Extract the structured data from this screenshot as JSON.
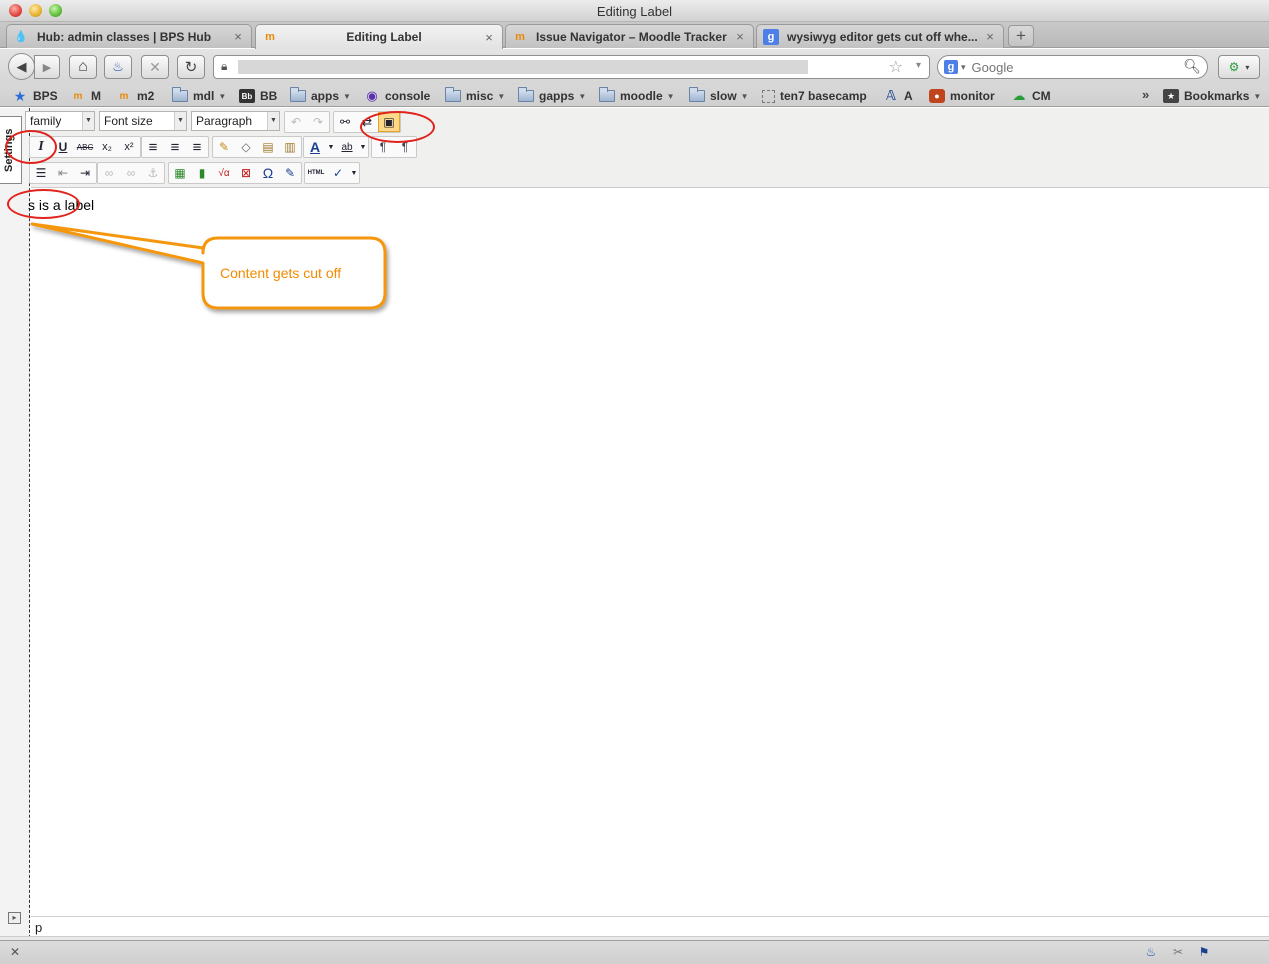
{
  "window": {
    "title": "Editing Label"
  },
  "tabs": [
    {
      "label": "Hub: admin classes | BPS Hub",
      "icon": "drupal-icon",
      "close": "×"
    },
    {
      "label": "Editing Label",
      "icon": "moodle-icon",
      "close": "×"
    },
    {
      "label": "Issue Navigator – Moodle Tracker",
      "icon": "moodle-tracker-icon",
      "close": "×"
    },
    {
      "label": "wysiwyg editor gets cut off whe...",
      "icon": "google-icon",
      "close": "×"
    }
  ],
  "new_tab_label": "+",
  "navbar": {
    "back": "◀",
    "forward": "▶",
    "home": "⌂",
    "firebug": "🔥",
    "stop": "✕",
    "reload": "↻",
    "lock": "🔒",
    "star": "☆",
    "url_dropdown": "▾",
    "search_engine": "g",
    "search_placeholder": "Google",
    "search_icon": "⚲"
  },
  "bookmarks": [
    {
      "label": "BPS",
      "icon": "star-bookmark-icon",
      "dropdown": false
    },
    {
      "label": "M",
      "icon": "moodle-bookmark-icon",
      "dropdown": false
    },
    {
      "label": "m2",
      "icon": "moodle-bookmark-icon",
      "dropdown": false
    },
    {
      "label": "mdl",
      "icon": "folder-icon",
      "dropdown": true
    },
    {
      "label": "BB",
      "icon": "blackboard-icon",
      "dropdown": false
    },
    {
      "label": "apps",
      "icon": "folder-icon",
      "dropdown": true
    },
    {
      "label": "console",
      "icon": "console-icon",
      "dropdown": false
    },
    {
      "label": "misc",
      "icon": "folder-icon",
      "dropdown": true
    },
    {
      "label": "gapps",
      "icon": "folder-icon",
      "dropdown": true
    },
    {
      "label": "moodle",
      "icon": "folder-icon",
      "dropdown": true
    },
    {
      "label": "slow",
      "icon": "folder-icon",
      "dropdown": true
    },
    {
      "label": "ten7 basecamp",
      "icon": "page-icon",
      "dropdown": false
    },
    {
      "label": "A",
      "icon": "a-icon",
      "dropdown": false
    },
    {
      "label": "monitor",
      "icon": "monitor-icon",
      "dropdown": false
    },
    {
      "label": "CM",
      "icon": "cm-icon",
      "dropdown": false
    }
  ],
  "bookmarks_overflow": "»",
  "bookmarks_menu": "Bookmarks",
  "editor": {
    "settings_tab": "Settings",
    "font_family": "Font family",
    "font_family_visible": "family",
    "font_size": "Font size",
    "format": "Paragraph",
    "content_text": "This is a label",
    "content_visible": "s is a label",
    "path": "p",
    "toolbar_row1": [
      {
        "name": "undo-icon",
        "glyph": "↶",
        "disabled": true
      },
      {
        "name": "redo-icon",
        "glyph": "↷",
        "disabled": true
      },
      {
        "name": "find-icon",
        "glyph": "⚯",
        "disabled": false
      },
      {
        "name": "replace-icon",
        "glyph": "⇄",
        "disabled": false
      },
      {
        "name": "fullscreen-icon",
        "glyph": "▣",
        "disabled": false,
        "active": true
      }
    ],
    "toolbar_row2": [
      {
        "name": "italic-icon",
        "glyph": "I"
      },
      {
        "name": "underline-icon",
        "glyph": "U"
      },
      {
        "name": "strikethrough-icon",
        "glyph": "ABC"
      },
      {
        "name": "subscript-icon",
        "glyph": "x₂"
      },
      {
        "name": "superscript-icon",
        "glyph": "x²"
      },
      {
        "name": "align-left-icon",
        "glyph": "≡"
      },
      {
        "name": "align-center-icon",
        "glyph": "≡"
      },
      {
        "name": "align-right-icon",
        "glyph": "≡"
      },
      {
        "name": "cleanup-icon",
        "glyph": "🧹"
      },
      {
        "name": "eraser-icon",
        "glyph": "⌫"
      },
      {
        "name": "paste-text-icon",
        "glyph": "📋"
      },
      {
        "name": "paste-word-icon",
        "glyph": "📋"
      },
      {
        "name": "text-color-icon",
        "glyph": "A"
      },
      {
        "name": "highlight-color-icon",
        "glyph": "ab"
      },
      {
        "name": "ltr-icon",
        "glyph": "¶"
      },
      {
        "name": "rtl-icon",
        "glyph": "¶"
      }
    ],
    "toolbar_row3": [
      {
        "name": "unordered-list-icon",
        "glyph": "☰"
      },
      {
        "name": "outdent-icon",
        "glyph": "⇤"
      },
      {
        "name": "indent-icon",
        "glyph": "⇥"
      },
      {
        "name": "link-icon",
        "glyph": "🔗",
        "disabled": true
      },
      {
        "name": "unlink-icon",
        "glyph": "⛓",
        "disabled": true
      },
      {
        "name": "anchor-icon",
        "glyph": "⚓",
        "disabled": true
      },
      {
        "name": "image-icon",
        "glyph": "▦"
      },
      {
        "name": "media-icon",
        "glyph": "▮"
      },
      {
        "name": "equation-icon",
        "glyph": "√α"
      },
      {
        "name": "nolink-icon",
        "glyph": "⊠"
      },
      {
        "name": "special-char-icon",
        "glyph": "Ω"
      },
      {
        "name": "edit-icon",
        "glyph": "✎"
      },
      {
        "name": "html-icon",
        "glyph": "HTML"
      },
      {
        "name": "spellcheck-icon",
        "glyph": "✓"
      }
    ]
  },
  "annotation": {
    "callout_text": "Content gets cut off"
  },
  "statusbar": {
    "close": "✕"
  },
  "colors": {
    "callout": "#f28a00",
    "ring": "#e0231c",
    "active_button": "#fcd98a"
  }
}
